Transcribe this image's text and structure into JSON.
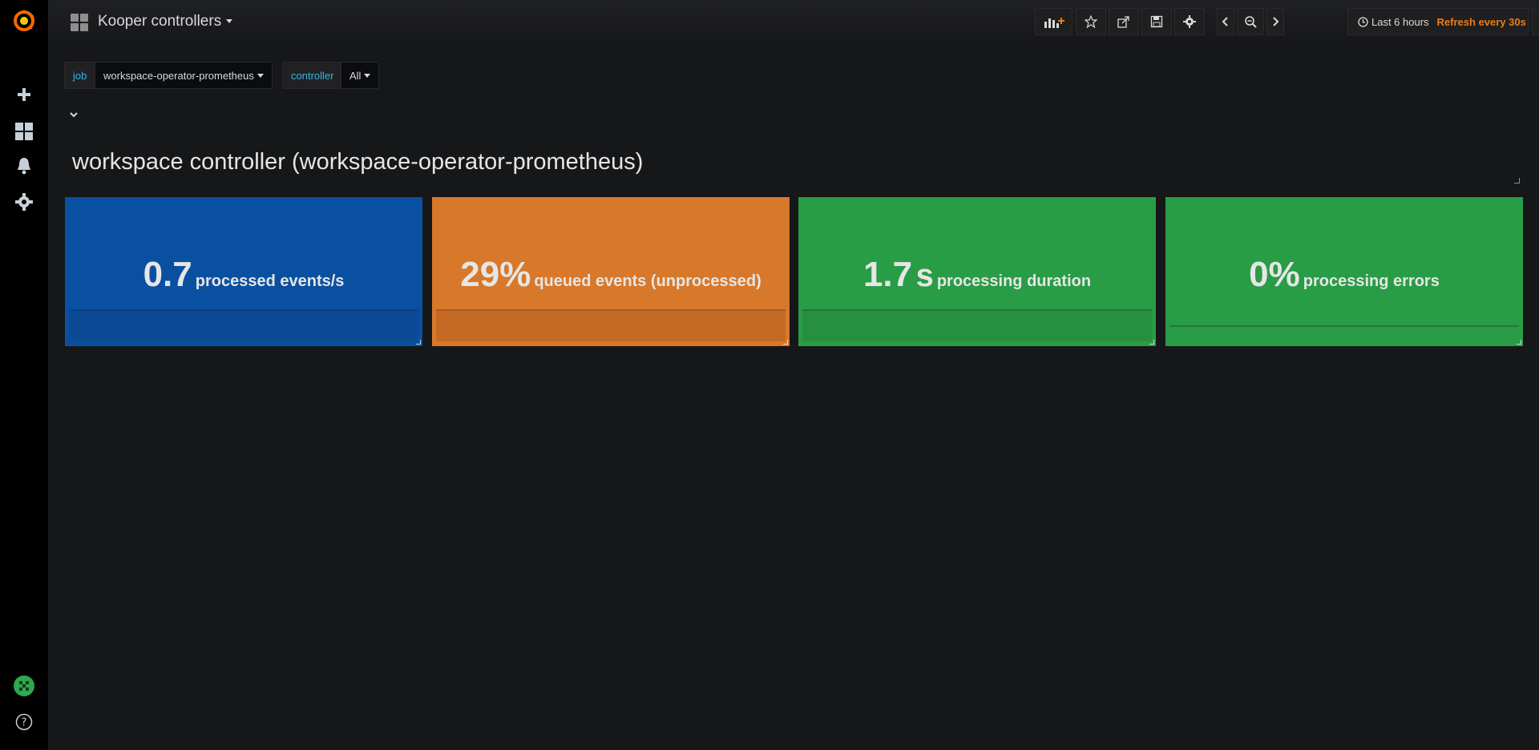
{
  "dashboard": {
    "title": "Kooper controllers"
  },
  "sidebar": {
    "items": [
      {
        "name": "grafana-logo-icon"
      },
      {
        "name": "create-plus-icon"
      },
      {
        "name": "dashboards-icon"
      },
      {
        "name": "alerting-bell-icon"
      },
      {
        "name": "configuration-gear-icon"
      },
      {
        "name": "user-avatar"
      },
      {
        "name": "help-icon"
      }
    ]
  },
  "toolbar": {
    "time_range": "Last 6 hours",
    "refresh": "Refresh every 30s"
  },
  "variables": [
    {
      "label": "job",
      "value": "workspace-operator-prometheus"
    },
    {
      "label": "controller",
      "value": "All"
    }
  ],
  "row": {
    "title": "workspace controller (workspace-operator-prometheus)"
  },
  "panels": [
    {
      "value": "0.7",
      "unit": "",
      "label": "processed events/s",
      "color": "#0a50a1",
      "fill_color": "#0c4a96",
      "line_color": "#0a3f82"
    },
    {
      "value": "29%",
      "unit": "",
      "label": "queued events (unprocessed)",
      "color": "#d8782a",
      "fill_color": "#c46a24",
      "line_color": "#a85a1e"
    },
    {
      "value": "1.7",
      "unit": "s",
      "label": "processing duration",
      "color": "#299c46",
      "fill_color": "#268f40",
      "line_color": "#1f7a36"
    },
    {
      "value": "0%",
      "unit": "",
      "label": "processing errors",
      "color": "#299c46",
      "fill_color": "#299c46",
      "line_color": "#1f7a36"
    }
  ],
  "colors": {
    "accent_orange": "#eb7b18",
    "variable_label": "#33b5e5",
    "background": "#161719"
  }
}
